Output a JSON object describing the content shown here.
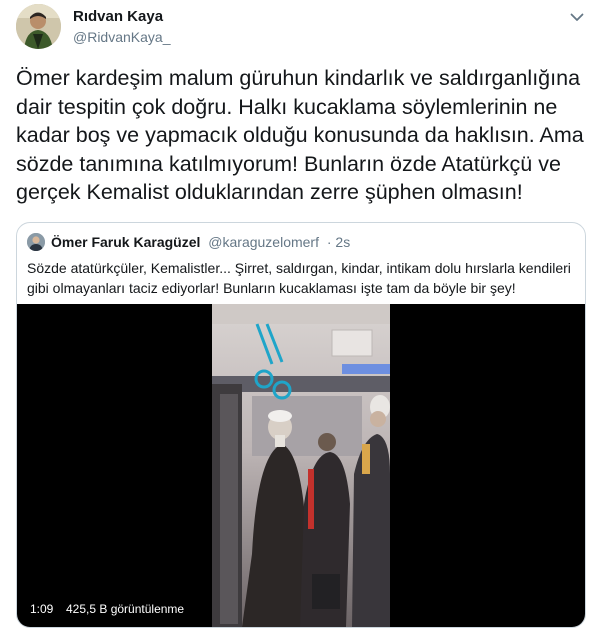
{
  "author": {
    "display_name": "Rıdvan Kaya",
    "handle": "@RidvanKaya_",
    "avatar_icon": "user-avatar"
  },
  "tweet": {
    "text": "Ömer kardeşim malum güruhun kindarlık ve saldırganlığına\ndair tespitin çok doğru. Halkı kucaklama söylemlerinin ne\nkadar boş ve yapmacık olduğu konusunda da haklısın. Ama\nsözde tanımına katılmıyorum! Bunların özde Atatürkçü ve\ngerçek Kemalist olduklarından zerre şüphen olmasın!"
  },
  "quoted_tweet": {
    "display_name": "Ömer Faruk Karagüzel",
    "handle": "@karaguzelomerf",
    "time": "· 2s",
    "text": "Sözde atatürkçüler, Kemalistler... Şirret, saldırgan, kindar, intikam dolu hırslarla kendileri gibi olmayanları taciz ediyorlar! Bunların kucaklaması işte tam da böyle bir şey!",
    "video": {
      "duration": "1:09",
      "views": "425,5 B görüntülenme"
    }
  },
  "colors": {
    "text_primary": "#14171a",
    "text_secondary": "#657786",
    "border": "#ccd6dd",
    "video_bg": "#000000"
  }
}
